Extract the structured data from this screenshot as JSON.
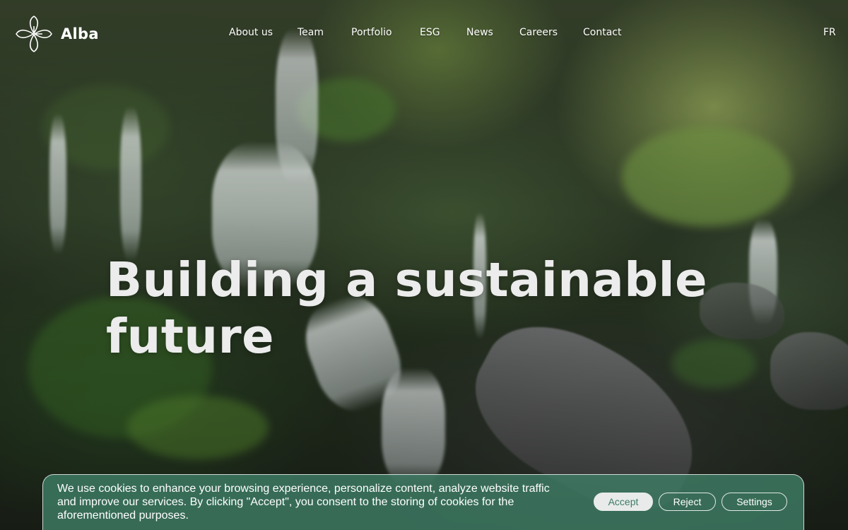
{
  "brand": {
    "name": "Alba",
    "logo_icon": "flower-logo-icon"
  },
  "nav": {
    "items": [
      {
        "label": "About us"
      },
      {
        "label": "Team"
      },
      {
        "label": "Portfolio"
      },
      {
        "label": "ESG"
      },
      {
        "label": "News"
      },
      {
        "label": "Careers"
      },
      {
        "label": "Contact"
      }
    ],
    "language_toggle": "FR"
  },
  "hero": {
    "headline_line1": "Building a sustainable",
    "headline_line2": "future",
    "background": "waterfall-forest-photo"
  },
  "cookie_banner": {
    "message": "We use cookies to enhance your browsing experience, personalize content, analyze website traffic and improve our services. By clicking \"Accept\", you consent to the storing of cookies for the aforementioned purposes.",
    "accept_label": "Accept",
    "reject_label": "Reject",
    "settings_label": "Settings"
  },
  "colors": {
    "banner_background": "#3e7c65",
    "accept_button_background": "#e8ebea",
    "headline_text": "#ececec"
  }
}
